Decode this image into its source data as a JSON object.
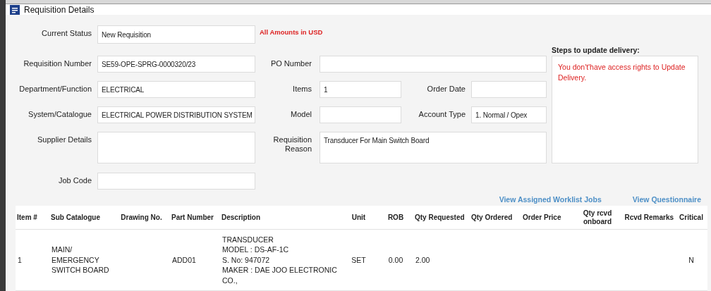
{
  "window": {
    "title": "Requisition Details"
  },
  "fields": [
    {
      "label": "Current Status",
      "value": "New Requisition"
    },
    {
      "label": "Requisition Number",
      "value": "SE59-OPE-SPRG-0000320/23"
    },
    {
      "label": "PO Number"
    },
    {
      "label": "Department/Function",
      "value": "ELECTRICAL"
    },
    {
      "label": "Items",
      "value": "1"
    },
    {
      "label": "Order Date"
    },
    {
      "label": "System/Catalogue",
      "value": "ELECTRICAL POWER DISTRIBUTION SYSTEM"
    },
    {
      "label": "Model"
    },
    {
      "label": "Account Type",
      "value": "1. Normal / Opex"
    },
    {
      "label": "Supplier Details"
    },
    {
      "label": "Requisition Reason",
      "value": "Transducer For Main Switch Board"
    },
    {
      "label": "Job Code"
    }
  ],
  "currency_note": "All Amounts in USD",
  "delivery_panel": {
    "heading": "Steps to update delivery:",
    "message": "You don't'have access rights to Update Delivery."
  },
  "links": [
    "View Assigned Worklist Jobs",
    "View Questionnaire"
  ],
  "table": {
    "columns": [
      "Item #",
      "Sub Catalogue",
      "Drawing No.",
      "Part Number",
      "Description",
      "Unit",
      "ROB",
      "Qty Requested",
      "Qty Ordered",
      "Order Price",
      "Qty rcvd onboard",
      "Rcvd Remarks",
      "Critical"
    ],
    "rows": [
      {
        "cells": [
          "1",
          "MAIN/\nEMERGENCY\nSWITCH BOARD",
          null,
          "ADD01",
          "TRANSDUCER\nMODEL : DS-AF-1C\nS. No: 947072\nMAKER : DAE JOO ELECTRONIC CO.,",
          "SET",
          "0.00",
          "2.00",
          null,
          null,
          null,
          null,
          "N"
        ]
      }
    ]
  }
}
